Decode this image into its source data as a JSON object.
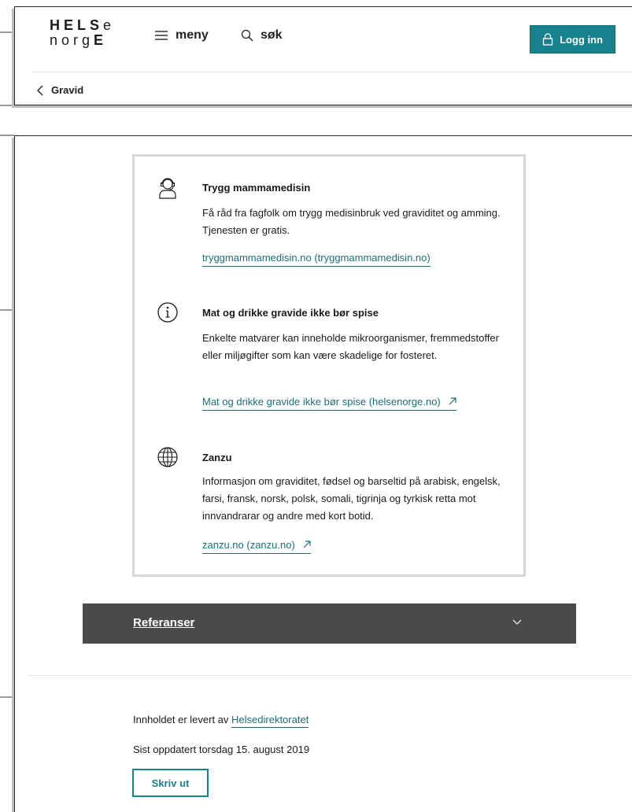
{
  "header": {
    "logo_top": [
      "H",
      "E",
      "L",
      "S",
      "e"
    ],
    "logo_bottom": [
      "n",
      "o",
      "r",
      "g",
      "E"
    ],
    "menu_label": "meny",
    "search_label": "søk",
    "login_label": "Logg inn"
  },
  "breadcrumb": {
    "back_label": "Gravid"
  },
  "items": [
    {
      "icon": "headset-person-icon",
      "title": "Trygg mammamedisin",
      "description": "Få råd fra fagfolk om trygg medisinbruk ved graviditet og amming. Tjenesten er gratis.",
      "link": "tryggmammamedisin.no (tryggmammamedisin.no)"
    },
    {
      "icon": "info-circle-icon",
      "title": "Mat og drikke gravide ikke bør spise",
      "description": "Enkelte matvarer kan inneholde mikroorganismer, fremmedstoffer eller miljøgifter som kan være skadelige for fosteret.",
      "link": "Mat og drikke gravide ikke bør spise (helsenorge.no)"
    },
    {
      "icon": "globe-icon",
      "title": "Zanzu",
      "description": "Informasjon om graviditet, fødsel og barseltid på arabisk, engelsk, farsi, fransk, norsk, polsk, somali, tigrinja og tyrkisk retta mot innvandrarar og andre med kort botid.",
      "link": "zanzu.no (zanzu.no)"
    }
  ],
  "references": {
    "label": "Referanser"
  },
  "footer": {
    "provided_prefix": "Innholdet er levert av",
    "provided_link": "Helsedirektoratet",
    "updated": "Sist oppdatert torsdag 15. august 2019",
    "print_label": "Skriv ut"
  },
  "colors": {
    "accent": "#17818d",
    "link": "#1c6e78",
    "accordion_bg": "#4a4a48",
    "box_border": "#d8d8d8"
  }
}
